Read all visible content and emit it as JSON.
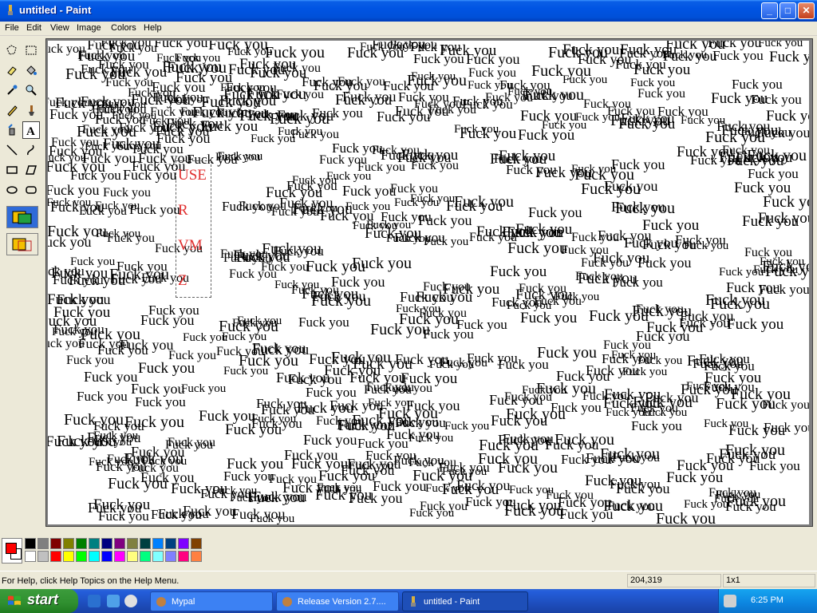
{
  "window": {
    "title": "untitled - Paint",
    "controls": {
      "minimize": "_",
      "maximize": "□",
      "close": "✕"
    }
  },
  "menu": [
    "File",
    "Edit",
    "View",
    "Image",
    "Colors",
    "Help"
  ],
  "toolbox": {
    "tools": [
      {
        "name": "free-form-select-icon"
      },
      {
        "name": "select-icon"
      },
      {
        "name": "eraser-icon"
      },
      {
        "name": "fill-icon"
      },
      {
        "name": "pick-color-icon"
      },
      {
        "name": "magnifier-icon"
      },
      {
        "name": "pencil-icon"
      },
      {
        "name": "brush-icon"
      },
      {
        "name": "airbrush-icon"
      },
      {
        "name": "text-icon",
        "active": true
      },
      {
        "name": "line-icon"
      },
      {
        "name": "curve-icon"
      },
      {
        "name": "rectangle-icon"
      },
      {
        "name": "polygon-icon"
      },
      {
        "name": "ellipse-icon"
      },
      {
        "name": "rounded-rectangle-icon"
      }
    ]
  },
  "canvas": {
    "scribble_text": "Fuck you",
    "textbox_lines": [
      "USE",
      "R",
      "VM",
      "Z"
    ]
  },
  "palette": {
    "foreground": "#ff0000",
    "background": "#ffffff",
    "colors_top": [
      "#000000",
      "#808080",
      "#800000",
      "#808000",
      "#008000",
      "#008080",
      "#000080",
      "#800080",
      "#808040",
      "#004040",
      "#0080ff",
      "#004080",
      "#8000ff",
      "#804000"
    ],
    "colors_bottom": [
      "#ffffff",
      "#c0c0c0",
      "#ff0000",
      "#ffff00",
      "#00ff00",
      "#00ffff",
      "#0000ff",
      "#ff00ff",
      "#ffff80",
      "#00ff80",
      "#80ffff",
      "#8080ff",
      "#ff0080",
      "#ff8040"
    ]
  },
  "status": {
    "help": "For Help, click Help Topics on the Help Menu.",
    "coords": "204,319",
    "size": "1x1"
  },
  "taskbar": {
    "start_label": "start",
    "tasks": [
      {
        "label": "Mypal",
        "active": false
      },
      {
        "label": "Release Version 2.7....",
        "active": false
      },
      {
        "label": "untitled - Paint",
        "active": true
      }
    ],
    "clock": "6:25 PM"
  }
}
